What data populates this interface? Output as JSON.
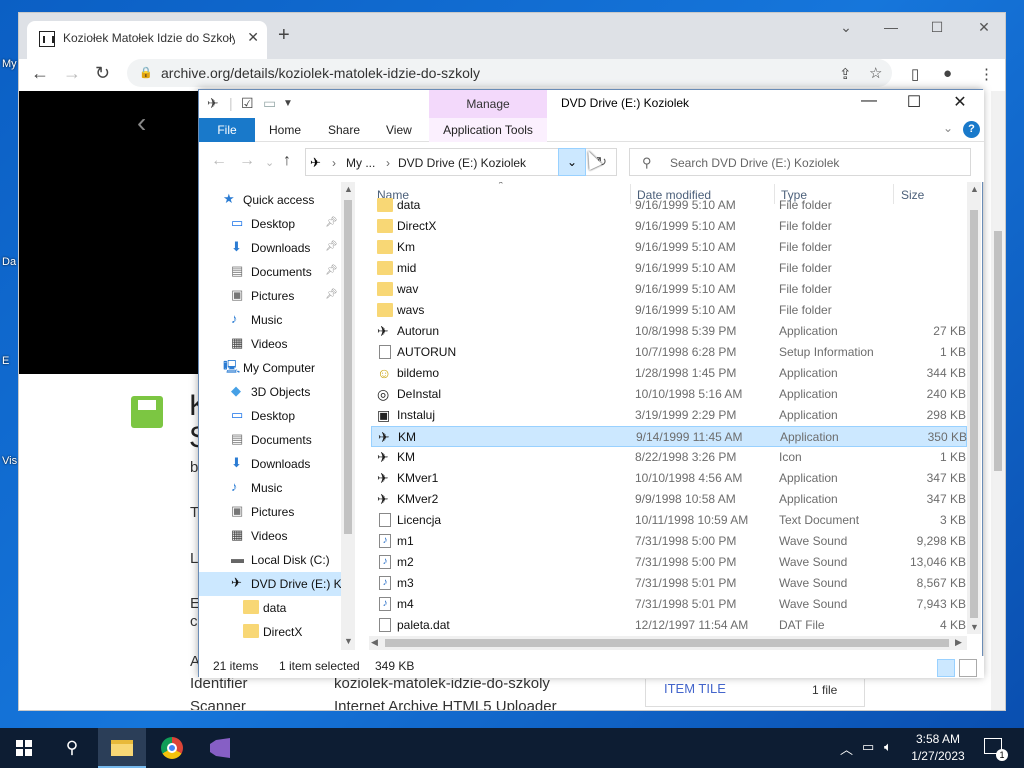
{
  "desktop": {
    "labels": [
      "My",
      "Da",
      "E",
      "Vis"
    ]
  },
  "chrome": {
    "tab_title": "Koziołek Matołek Idzie do Szkoły",
    "close_glyph": "✕",
    "new_tab_glyph": "+",
    "url": "archive.org/details/koziolek-matolek-idzie-do-szkoly"
  },
  "page": {
    "big1": "K",
    "big2": "S",
    "small1": "b",
    "t1": "T",
    "t2": "L",
    "t3": "E",
    "t4": "cl",
    "t5": "A",
    "identifier_label": "Identifier",
    "identifier_value": "koziolek-matolek-idzie-do-szkoly",
    "scanner_label": "Scanner",
    "scanner_value": "Internet Archive HTML5 Uploader",
    "item_tile": "ITEM TILE",
    "file_count": "1 file"
  },
  "explorer": {
    "title": "DVD Drive (E:) Koziolek",
    "manage": "Manage",
    "ribbon": {
      "file": "File",
      "home": "Home",
      "share": "Share",
      "view": "View",
      "app_tools": "Application Tools"
    },
    "address": {
      "crumb1": "My ...",
      "crumb2": "DVD Drive (E:) Koziolek"
    },
    "search_placeholder": "Search DVD Drive (E:) Koziolek",
    "nav": [
      {
        "label": "Quick access",
        "icon": "star-icon",
        "indent": 0,
        "pin": false
      },
      {
        "label": "Desktop",
        "icon": "desktop-icon",
        "indent": 1,
        "pin": true
      },
      {
        "label": "Downloads",
        "icon": "download-icon",
        "indent": 1,
        "pin": true
      },
      {
        "label": "Documents",
        "icon": "documents-icon",
        "indent": 1,
        "pin": true
      },
      {
        "label": "Pictures",
        "icon": "pictures-icon",
        "indent": 1,
        "pin": true
      },
      {
        "label": "Music",
        "icon": "music-icon",
        "indent": 1,
        "pin": false
      },
      {
        "label": "Videos",
        "icon": "videos-icon",
        "indent": 1,
        "pin": false
      },
      {
        "label": "My Computer",
        "icon": "computer-icon",
        "indent": 0,
        "pin": false
      },
      {
        "label": "3D Objects",
        "icon": "cube-icon",
        "indent": 1,
        "pin": false
      },
      {
        "label": "Desktop",
        "icon": "desktop-icon",
        "indent": 1,
        "pin": false
      },
      {
        "label": "Documents",
        "icon": "documents-icon",
        "indent": 1,
        "pin": false
      },
      {
        "label": "Downloads",
        "icon": "download-icon",
        "indent": 1,
        "pin": false
      },
      {
        "label": "Music",
        "icon": "music-icon",
        "indent": 1,
        "pin": false
      },
      {
        "label": "Pictures",
        "icon": "pictures-icon",
        "indent": 1,
        "pin": false
      },
      {
        "label": "Videos",
        "icon": "videos-icon",
        "indent": 1,
        "pin": false
      },
      {
        "label": "Local Disk (C:)",
        "icon": "disk-icon",
        "indent": 1,
        "pin": false
      },
      {
        "label": "DVD Drive (E:) Ko",
        "icon": "dvd-icon",
        "indent": 1,
        "pin": false,
        "selected": true
      },
      {
        "label": "data",
        "icon": "folder-icon",
        "indent": 2,
        "pin": false
      },
      {
        "label": "DirectX",
        "icon": "folder-icon",
        "indent": 2,
        "pin": false
      }
    ],
    "columns": {
      "name": "Name",
      "date": "Date modified",
      "type": "Type",
      "size": "Size"
    },
    "files": [
      {
        "name": "data",
        "date": "9/16/1999 5:10 AM",
        "type": "File folder",
        "size": "",
        "icon": "folder"
      },
      {
        "name": "DirectX",
        "date": "9/16/1999 5:10 AM",
        "type": "File folder",
        "size": "",
        "icon": "folder"
      },
      {
        "name": "Km",
        "date": "9/16/1999 5:10 AM",
        "type": "File folder",
        "size": "",
        "icon": "folder"
      },
      {
        "name": "mid",
        "date": "9/16/1999 5:10 AM",
        "type": "File folder",
        "size": "",
        "icon": "folder"
      },
      {
        "name": "wav",
        "date": "9/16/1999 5:10 AM",
        "type": "File folder",
        "size": "",
        "icon": "folder"
      },
      {
        "name": "wavs",
        "date": "9/16/1999 5:10 AM",
        "type": "File folder",
        "size": "",
        "icon": "folder"
      },
      {
        "name": "Autorun",
        "date": "10/8/1998 5:39 PM",
        "type": "Application",
        "size": "27 KB",
        "icon": "app"
      },
      {
        "name": "AUTORUN",
        "date": "10/7/1998 6:28 PM",
        "type": "Setup Information",
        "size": "1 KB",
        "icon": "doc"
      },
      {
        "name": "bildemo",
        "date": "1/28/1998 1:45 PM",
        "type": "Application",
        "size": "344 KB",
        "icon": "app"
      },
      {
        "name": "DeInstal",
        "date": "10/10/1998 5:16 AM",
        "type": "Application",
        "size": "240 KB",
        "icon": "app"
      },
      {
        "name": "Instaluj",
        "date": "3/19/1999 2:29 PM",
        "type": "Application",
        "size": "298 KB",
        "icon": "app"
      },
      {
        "name": "KM",
        "date": "9/14/1999 11:45 AM",
        "type": "Application",
        "size": "350 KB",
        "icon": "app",
        "selected": true
      },
      {
        "name": "KM",
        "date": "8/22/1998 3:26 PM",
        "type": "Icon",
        "size": "1 KB",
        "icon": "app"
      },
      {
        "name": "KMver1",
        "date": "10/10/1998 4:56 AM",
        "type": "Application",
        "size": "347 KB",
        "icon": "app"
      },
      {
        "name": "KMver2",
        "date": "9/9/1998 10:58 AM",
        "type": "Application",
        "size": "347 KB",
        "icon": "app"
      },
      {
        "name": "Licencja",
        "date": "10/11/1998 10:59 AM",
        "type": "Text Document",
        "size": "3 KB",
        "icon": "doc"
      },
      {
        "name": "m1",
        "date": "7/31/1998 5:00 PM",
        "type": "Wave Sound",
        "size": "9,298 KB",
        "icon": "snd"
      },
      {
        "name": "m2",
        "date": "7/31/1998 5:00 PM",
        "type": "Wave Sound",
        "size": "13,046 KB",
        "icon": "snd"
      },
      {
        "name": "m3",
        "date": "7/31/1998 5:01 PM",
        "type": "Wave Sound",
        "size": "8,567 KB",
        "icon": "snd"
      },
      {
        "name": "m4",
        "date": "7/31/1998 5:01 PM",
        "type": "Wave Sound",
        "size": "7,943 KB",
        "icon": "snd"
      },
      {
        "name": "paleta.dat",
        "date": "12/12/1997 11:54 AM",
        "type": "DAT File",
        "size": "4 KB",
        "icon": "doc"
      }
    ],
    "status": {
      "items": "21 items",
      "selected": "1 item selected",
      "size": "349 KB"
    }
  },
  "taskbar": {
    "time": "3:58 AM",
    "date": "1/27/2023",
    "notifications": "1"
  }
}
